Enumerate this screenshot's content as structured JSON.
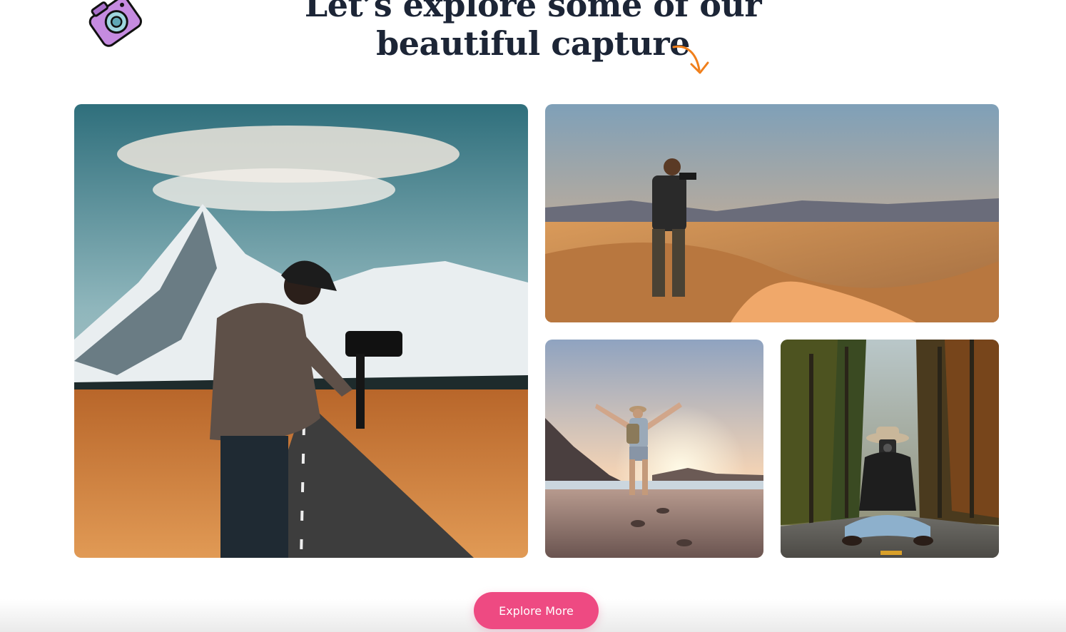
{
  "heading": {
    "line1": "Let’s explore some of our",
    "line2": "beautiful capture"
  },
  "decorations": {
    "camera_icon": "camera-icon",
    "arrow_icon": "curved-arrow-icon",
    "camera_color": "#c58be0",
    "arrow_color": "#f07f1b"
  },
  "gallery": [
    {
      "name": "filmmaker-road-mountain-photo"
    },
    {
      "name": "photographer-desert-dunes-photo"
    },
    {
      "name": "hiker-beach-sunset-photo"
    },
    {
      "name": "woman-camera-forest-road-photo"
    }
  ],
  "cta": {
    "label": "Explore More",
    "color": "#ee4a82"
  }
}
